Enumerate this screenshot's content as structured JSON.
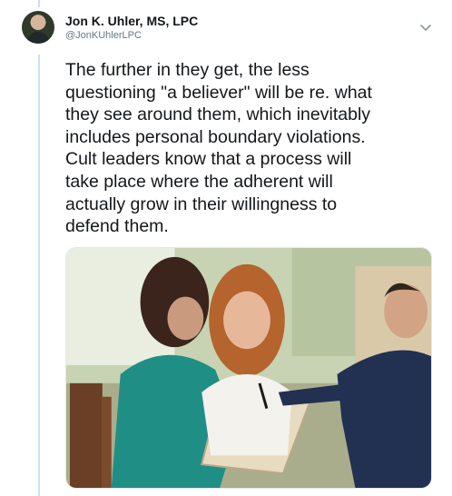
{
  "tweet": {
    "display_name": "Jon K. Uhler, MS, LPC",
    "handle": "@JonKUhlerLPC",
    "text": "The further in they get, the less\nquestioning \"a believer\" will be re. what\nthey see around them, which inevitably\nincludes personal boundary violations.\nCult leaders know that a process will\ntake place where the adherent will\nactually grow in their willingness to\ndefend them.",
    "menu_icon": "chevron-down-icon",
    "avatar_icon": "profile-photo"
  },
  "colors": {
    "text": "#14171a",
    "secondary_text": "#657786",
    "thread_line": "#c4e2f5"
  }
}
